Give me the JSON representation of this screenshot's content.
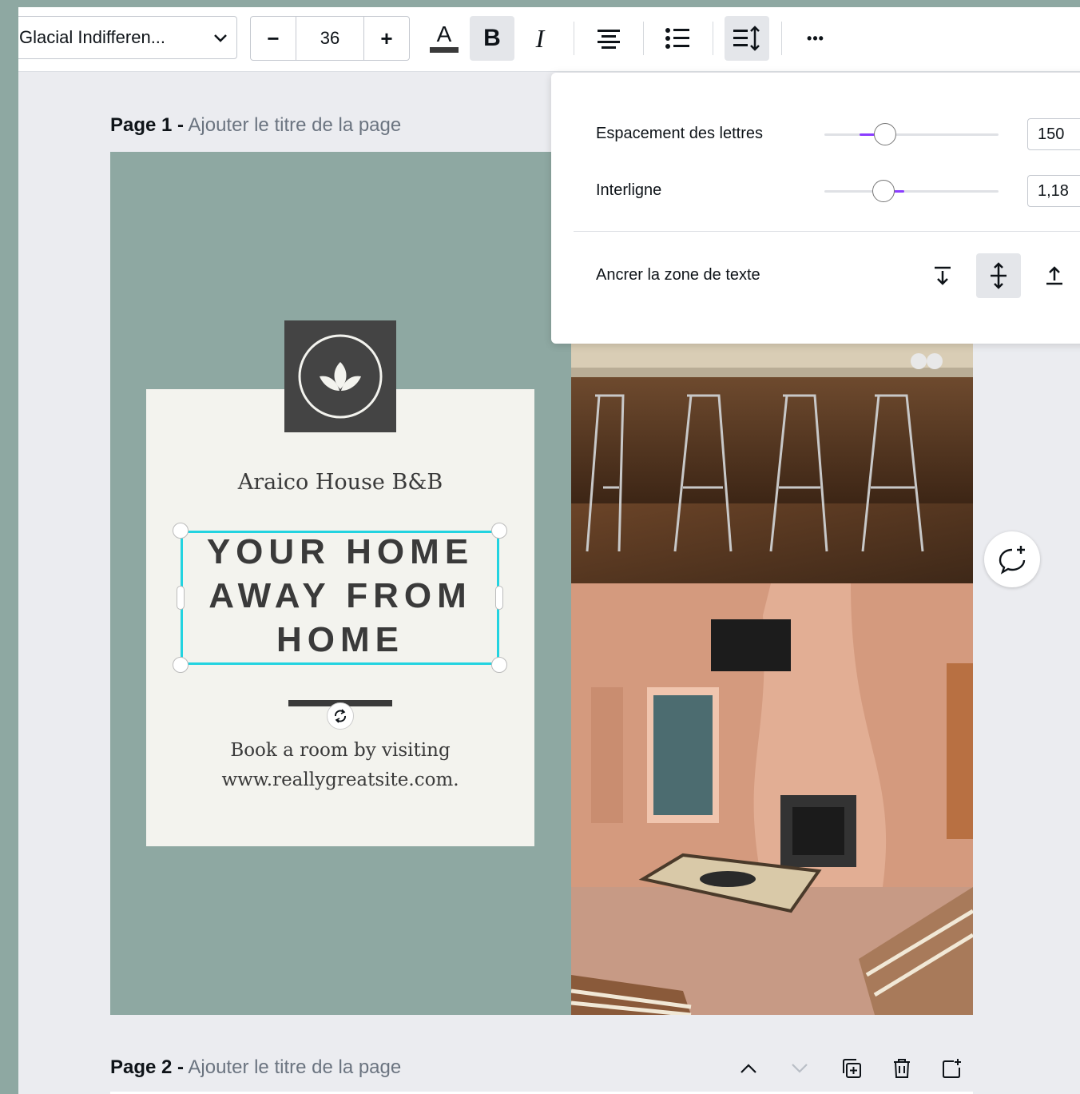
{
  "toolbar": {
    "font_name": "Glacial Indifferen...",
    "font_size": "36",
    "decrease_label": "−",
    "increase_label": "+",
    "bold_label": "B",
    "italic_label": "I",
    "more_label": "•••",
    "text_color": "#3a3a3a"
  },
  "pages": [
    {
      "label": "Page 1 -",
      "title_placeholder": "Ajouter le titre de la page"
    },
    {
      "label": "Page 2 -",
      "title_placeholder": "Ajouter le titre de la page"
    }
  ],
  "design": {
    "brand_name": "Araico House B&B",
    "headline": [
      "YOUR HOME",
      "AWAY FROM",
      "HOME"
    ],
    "cta_line1": "Book a room by visiting",
    "cta_line2": "www.reallygreatsite.com.",
    "background_color": "#8ea8a2",
    "card_color": "#f3f3ee"
  },
  "spacing_popover": {
    "letter_spacing_label": "Espacement des lettres",
    "letter_spacing_value": "150",
    "line_height_label": "Interligne",
    "line_height_value": "1,18",
    "anchor_label": "Ancrer la zone de texte",
    "accent": "#8b3dff"
  },
  "icons": {
    "comment": "add-comment-icon",
    "move_up": "chevron-up-icon",
    "move_down": "chevron-down-icon",
    "duplicate": "duplicate-page-icon",
    "delete": "trash-icon",
    "add_page": "add-page-icon"
  }
}
